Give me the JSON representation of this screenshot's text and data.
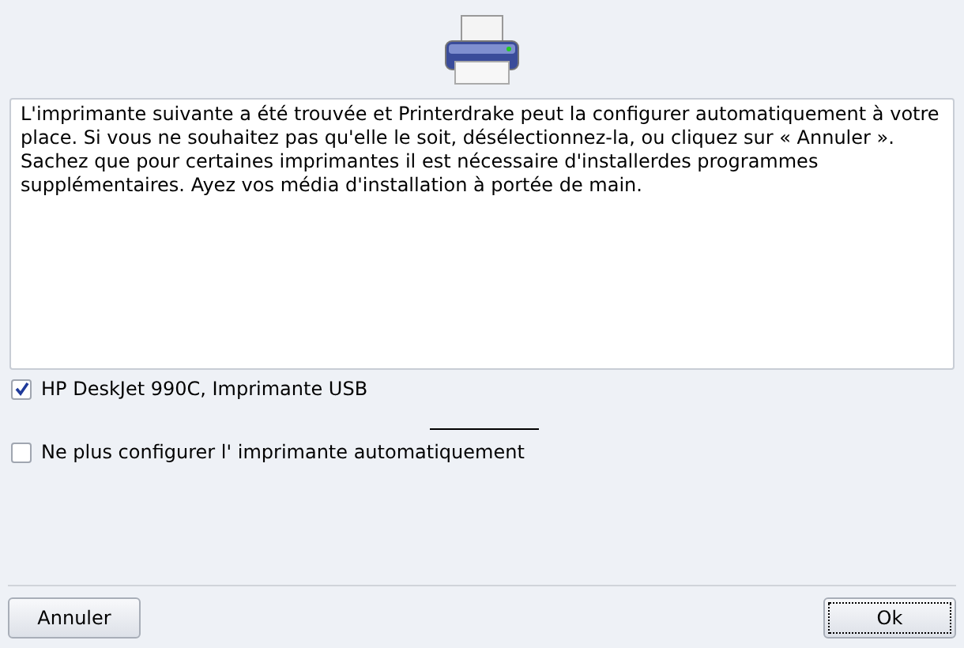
{
  "message": {
    "paragraphs": [
      "L'imprimante suivante a été trouvée et Printerdrake peut la configurer automatiquement à votre place. Si vous ne souhaitez pas qu'elle le soit, désélectionnez-la, ou cliquez sur « Annuler ».",
      "Sachez que pour certaines imprimantes il est nécessaire d'installerdes programmes supplémentaires. Ayez vos média d'installation à portée de main."
    ]
  },
  "options": [
    {
      "label": "HP DeskJet 990C, Imprimante USB",
      "checked": true
    },
    {
      "label": "Ne plus configurer l' imprimante automatiquement",
      "checked": false
    }
  ],
  "buttons": [
    {
      "label": "Annuler",
      "focused": false
    },
    {
      "label": "Ok",
      "focused": true
    }
  ]
}
